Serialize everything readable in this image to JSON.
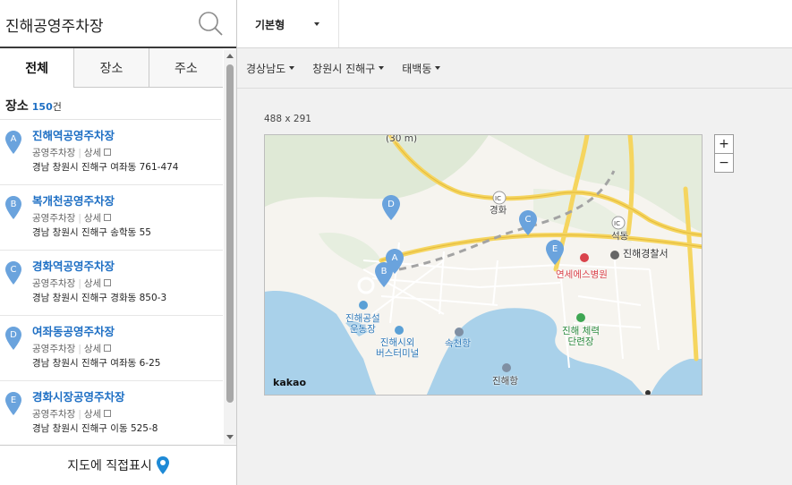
{
  "search": {
    "value": "진해공영주차장",
    "icon": "search-icon"
  },
  "tabs": [
    {
      "label": "전체",
      "active": true
    },
    {
      "label": "장소",
      "active": false
    },
    {
      "label": "주소",
      "active": false
    }
  ],
  "results": {
    "label": "장소",
    "count": "150",
    "unit": "건",
    "items": [
      {
        "marker": "A",
        "name": "진해역공영주차장",
        "category": "공영주차장",
        "detail": "상세",
        "address": "경남 창원시 진해구 여좌동 761-474"
      },
      {
        "marker": "B",
        "name": "복개천공영주차장",
        "category": "공영주차장",
        "detail": "상세",
        "address": "경남 창원시 진해구 송학동 55"
      },
      {
        "marker": "C",
        "name": "경화역공영주차장",
        "category": "공영주차장",
        "detail": "상세",
        "address": "경남 창원시 진해구 경화동 850-3"
      },
      {
        "marker": "D",
        "name": "여좌동공영주차장",
        "category": "공영주차장",
        "detail": "상세",
        "address": "경남 창원시 진해구 여좌동 6-25"
      },
      {
        "marker": "E",
        "name": "경화시장공영주차장",
        "category": "공영주차장",
        "detail": "상세",
        "address": "경남 창원시 진해구 이동 525-8"
      }
    ]
  },
  "direct_mark": {
    "label": "지도에 직접표시",
    "icon": "map-pin-icon"
  },
  "map_type": {
    "value": "기본형"
  },
  "regions": [
    {
      "label": "경상남도"
    },
    {
      "label": "창원시 진해구"
    },
    {
      "label": "태백동"
    }
  ],
  "map": {
    "size_label": "488 x 291",
    "attribution": "kakao",
    "zoom_in": "+",
    "zoom_out": "−",
    "labels": {
      "road_sign": "(30 m)",
      "ic1": "IC",
      "gyeonghwa": "경화",
      "ic2": "IC",
      "seokdong": "석동",
      "police": "진해경찰서",
      "hospital": "연세에스병원",
      "stadium_1": "진해공설",
      "stadium_2": "운동장",
      "terminal_1": "진해시외",
      "terminal_2": "버스터미널",
      "sokcheon": "속천항",
      "sports_1": "진해 체력",
      "sports_2": "단련장",
      "port": "진해항"
    },
    "markers": [
      "A",
      "B",
      "C",
      "D",
      "E"
    ]
  },
  "colors": {
    "accent": "#1e6fc4",
    "marker": "#6aa3dd",
    "water": "#a9d1ea",
    "road_major": "#f5d55f",
    "park": "#dfe9d6"
  }
}
